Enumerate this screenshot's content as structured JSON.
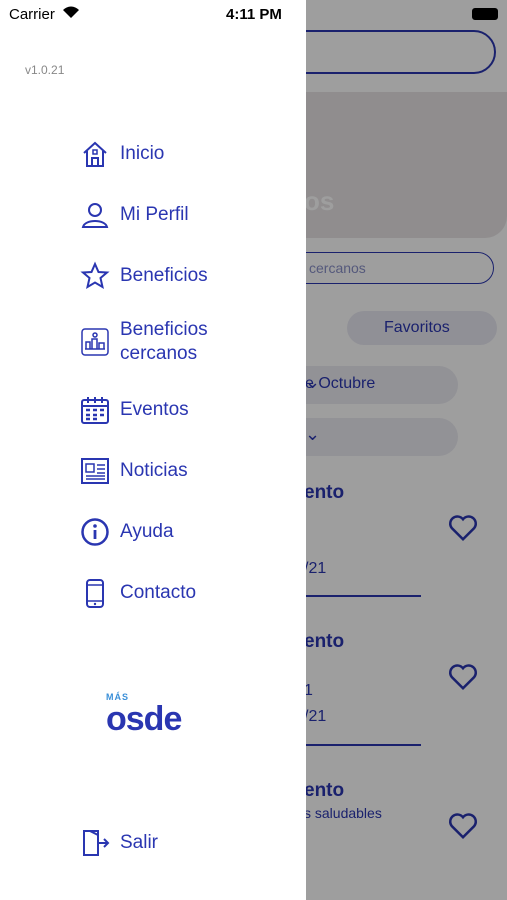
{
  "status_bar": {
    "carrier": "Carrier",
    "time": "4:11 PM"
  },
  "app": {
    "version": "v1.0.21"
  },
  "menu": [
    {
      "label": "Inicio",
      "icon": "home-icon"
    },
    {
      "label": "Mi Perfil",
      "icon": "user-icon"
    },
    {
      "label": "Beneficios",
      "icon": "star-icon"
    },
    {
      "label": "Beneficios\ncercanos",
      "icon": "map-icon"
    },
    {
      "label": "Eventos",
      "icon": "calendar-icon"
    },
    {
      "label": "Noticias",
      "icon": "newspaper-icon"
    },
    {
      "label": "Ayuda",
      "icon": "info-icon"
    },
    {
      "label": "Contacto",
      "icon": "phone-icon"
    }
  ],
  "logo": {
    "top": "MÁS",
    "brand": "osde"
  },
  "logout": {
    "label": "Salir",
    "icon": "logout-icon"
  },
  "background": {
    "hero_text": "os",
    "nearby_placeholder": "cercanos",
    "favorites_label": "Favoritos",
    "month_select": "e Octubre",
    "events": [
      {
        "title": "ento",
        "date": "/21"
      },
      {
        "title": "ento",
        "sub": "1",
        "date": "/21"
      },
      {
        "title": "ento",
        "sub": "s saludables"
      }
    ]
  },
  "colors": {
    "brand": "#2a36b1"
  }
}
